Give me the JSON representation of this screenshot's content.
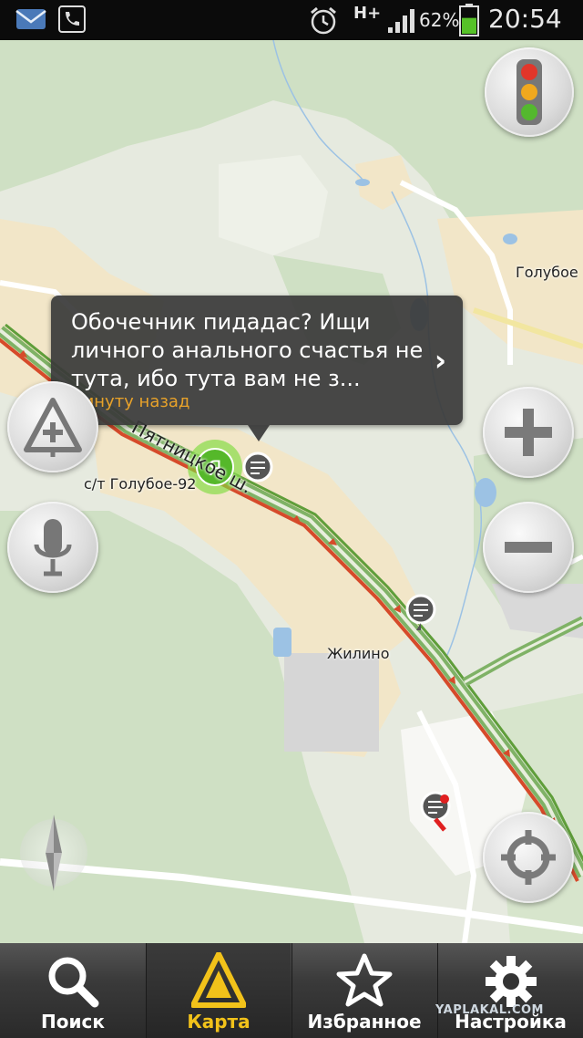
{
  "status_bar": {
    "network": "H+",
    "battery_percent": "62%",
    "battery_level": 0.62,
    "time": "20:54",
    "icons": [
      "mail-icon",
      "missed-call-icon",
      "alarm-icon",
      "signal-icon",
      "battery-icon"
    ]
  },
  "map": {
    "places": [
      {
        "name": "Голубое"
      },
      {
        "name": "с/т Голубое-92"
      },
      {
        "name": "Жилино"
      }
    ],
    "road_label": "Пятницкое ш.",
    "user_marker_letter": "Я"
  },
  "tooltip": {
    "message": "Обочечник пидадас? Ищи личного анального счастья не тута, ибо тута вам не з...",
    "time": "минуту назад"
  },
  "controls": {
    "traffic": "traffic-light-icon",
    "add_event": "add-road-event-icon",
    "voice": "microphone-icon",
    "zoom_in": "plus-icon",
    "zoom_out": "minus-icon",
    "compass": "compass-icon",
    "locate": "locate-me-icon"
  },
  "tabs": [
    {
      "label": "Поиск",
      "icon": "search-icon"
    },
    {
      "label": "Карта",
      "icon": "map-icon",
      "active": true
    },
    {
      "label": "Избранное",
      "icon": "star-icon"
    },
    {
      "label": "Настройка",
      "icon": "gear-icon"
    }
  ],
  "watermark": "YAPLAKAL.COM",
  "colors": {
    "traffic_red": "#d64a2a",
    "traffic_green": "#5f9e3a",
    "active_tab": "#f2c21a",
    "time_text": "#e8a22a"
  }
}
